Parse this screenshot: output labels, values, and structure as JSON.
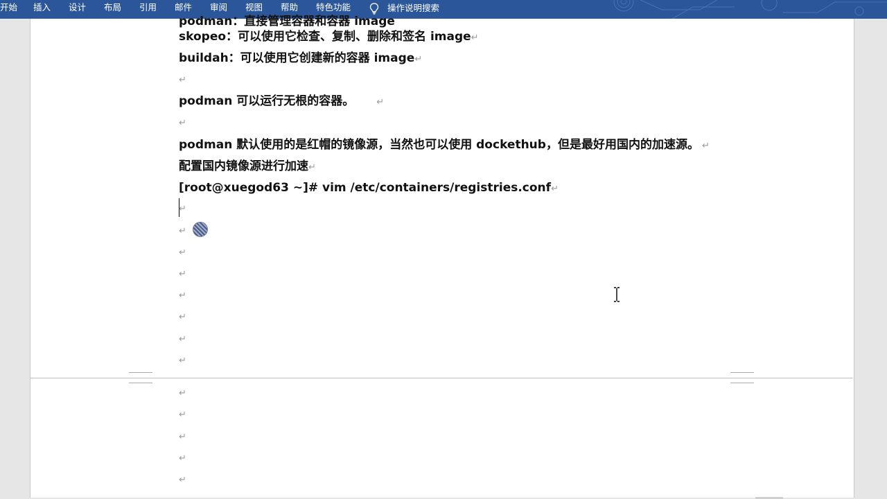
{
  "ribbon": {
    "tabs": [
      "开始",
      "插入",
      "设计",
      "布局",
      "引用",
      "邮件",
      "审阅",
      "视图",
      "帮助",
      "特色功能"
    ],
    "search_label": "操作说明搜索",
    "bar_color": "#2b579a"
  },
  "document": {
    "cut_line": "podman：直接管理容器和容器 image",
    "paragraph_mark": "↵",
    "lines": [
      "skopeo：可以使用它检查、复制、删除和签名 image",
      "buildah：可以使用它创建新的容器 image",
      "podman 可以运行无根的容器。",
      "podman 默认使用的是红帽的镜像源，当然也可以使用 dockethub，但是最好用国内的加速源。",
      "配置国内镜像源进行加速",
      "[root@xuegod63 ~]# vim /etc/containers/registries.conf"
    ]
  },
  "icons": {
    "search": "lightbulb-icon",
    "cursor": "ibeam-cursor-icon"
  }
}
